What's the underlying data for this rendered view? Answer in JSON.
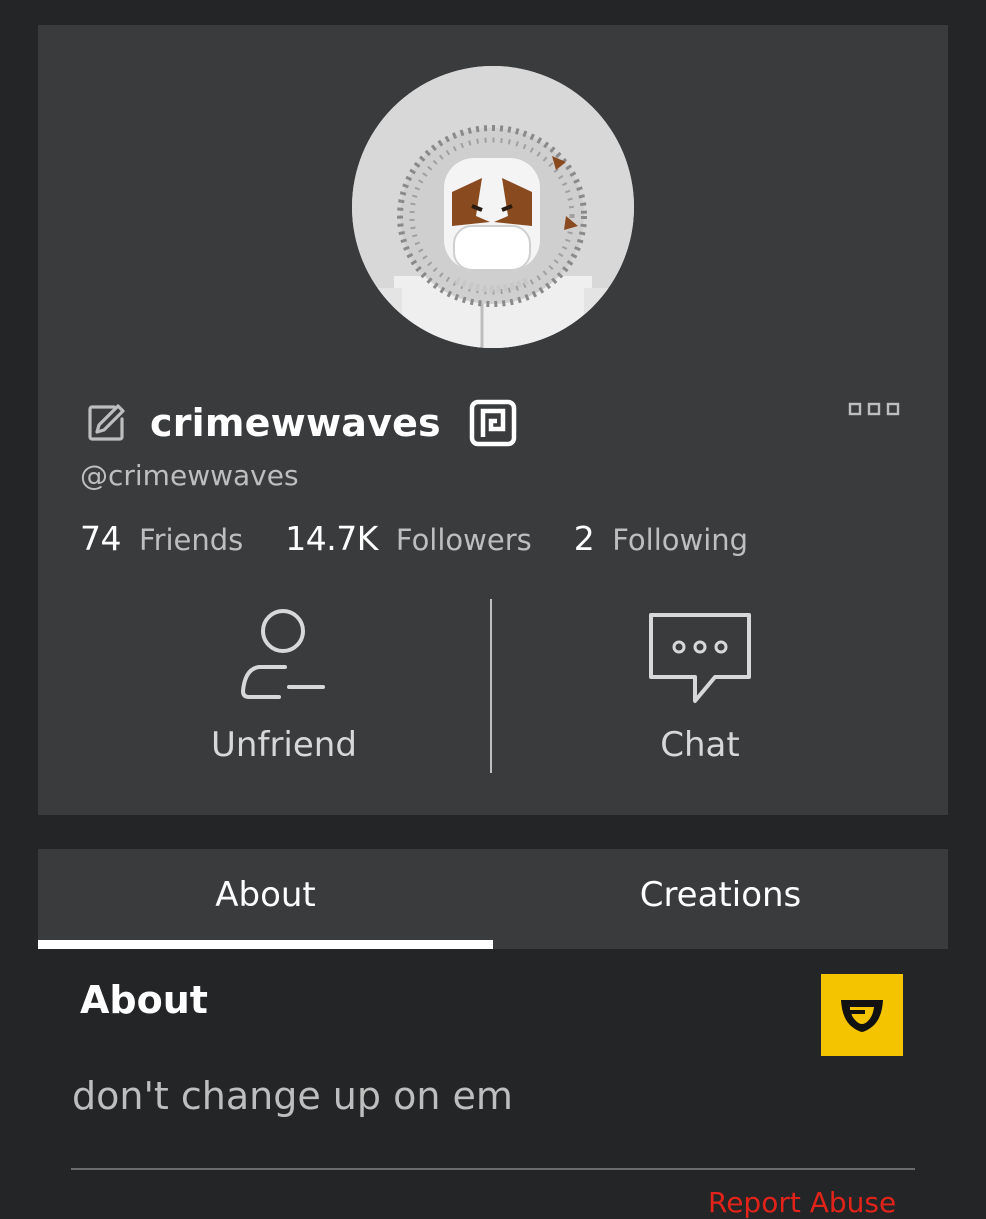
{
  "profile": {
    "display_name": "crimewwaves",
    "username": "@crimewwaves",
    "avatar_alt": "avatar",
    "stats": [
      {
        "count": "74",
        "label": "Friends"
      },
      {
        "count": "14.7K",
        "label": "Followers"
      },
      {
        "count": "2",
        "label": "Following"
      }
    ],
    "actions": {
      "unfriend_label": "Unfriend",
      "chat_label": "Chat"
    }
  },
  "tabs": [
    {
      "label": "About",
      "active": true
    },
    {
      "label": "Creations",
      "active": false
    }
  ],
  "about": {
    "heading": "About",
    "description": "don't change up on em",
    "report_label": "Report Abuse"
  },
  "icons": {
    "edit": "edit-icon",
    "premium": "premium-icon",
    "more": "more-options-icon",
    "unfriend": "unfriend-icon",
    "chat": "chat-icon",
    "guilded": "guilded-icon"
  },
  "colors": {
    "page_bg": "#232527",
    "card_bg": "#393b3d",
    "secondary_text": "#bdbebe",
    "guilded_yellow": "#f5c400",
    "report_red": "#e2231a"
  }
}
